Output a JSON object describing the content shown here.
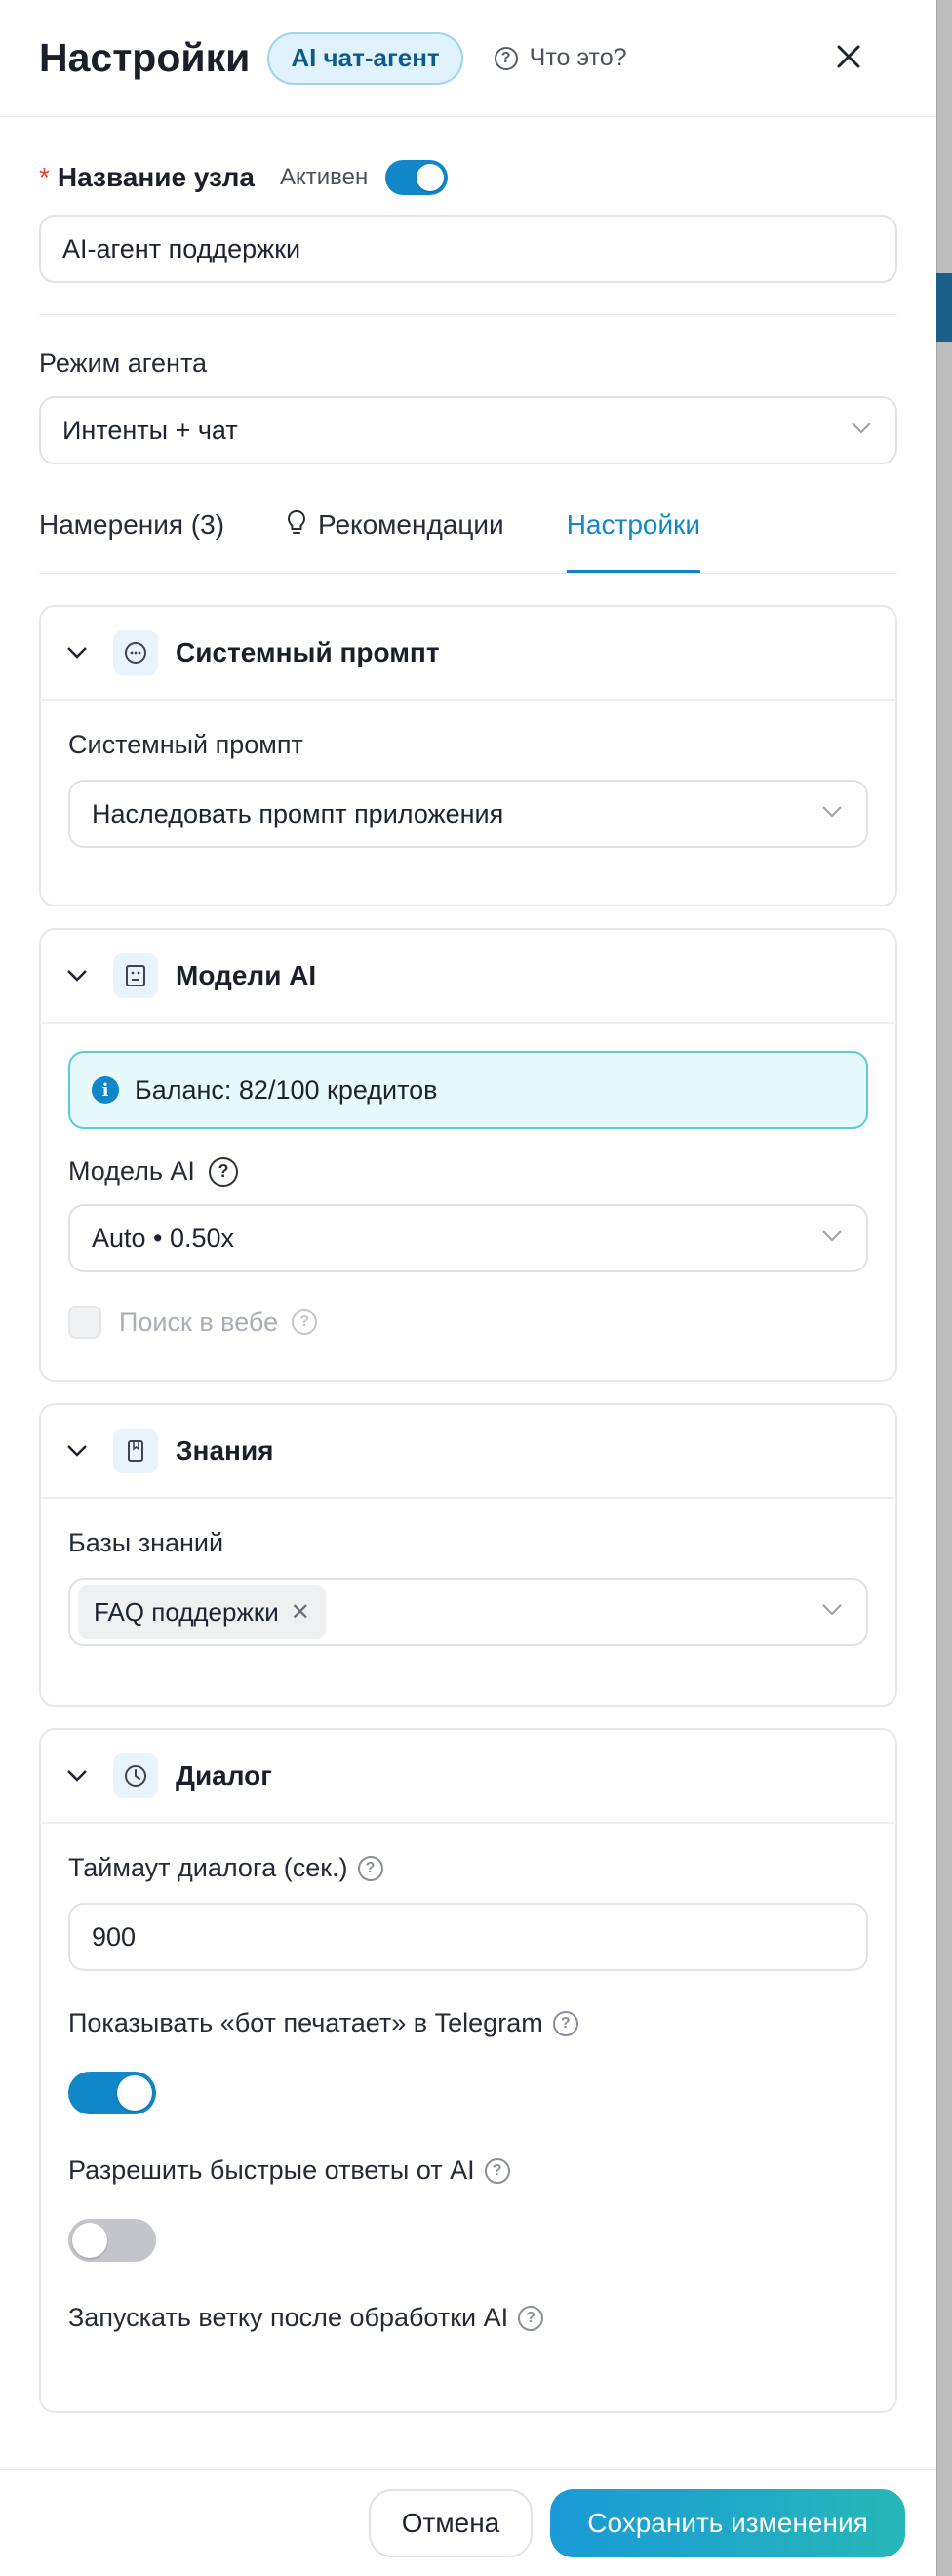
{
  "header": {
    "title": "Настройки",
    "badge": "AI чат-агент",
    "help": "Что это?"
  },
  "node": {
    "label": "Название узла",
    "required_mark": "*",
    "active_label": "Активен",
    "active": true,
    "name_value": "AI-агент поддержки"
  },
  "mode": {
    "label": "Режим агента",
    "value": "Интенты + чат"
  },
  "tabs": [
    {
      "label": "Намерения (3)",
      "active": false
    },
    {
      "label": "Рекомендации",
      "active": false
    },
    {
      "label": "Настройки",
      "active": true
    }
  ],
  "sections": {
    "system_prompt": {
      "title": "Системный промпт",
      "field_label": "Системный промпт",
      "value": "Наследовать промпт приложения"
    },
    "models": {
      "title": "Модели AI",
      "balance": "Баланс: 82/100 кредитов",
      "model_label": "Модель AI",
      "model_value": "Auto • 0.50x",
      "web_search_label": "Поиск в вебе",
      "web_search_checked": false
    },
    "knowledge": {
      "title": "Знания",
      "field_label": "Базы знаний",
      "tags": [
        "FAQ поддержки"
      ]
    },
    "dialog": {
      "title": "Диалог",
      "timeout_label": "Таймаут диалога (сек.)",
      "timeout_value": "900",
      "typing_label": "Показывать «бот печатает» в Telegram",
      "typing_on": true,
      "quick_label": "Разрешить быстрые ответы от AI",
      "quick_on": false,
      "branch_label": "Запускать ветку после обработки AI"
    }
  },
  "footer": {
    "cancel_label": "Отмена",
    "save_label": "Сохранить изменения"
  },
  "colors": {
    "accent": "#1186c9",
    "info_bg": "#e6fafc",
    "info_border": "#5ccbd9"
  }
}
